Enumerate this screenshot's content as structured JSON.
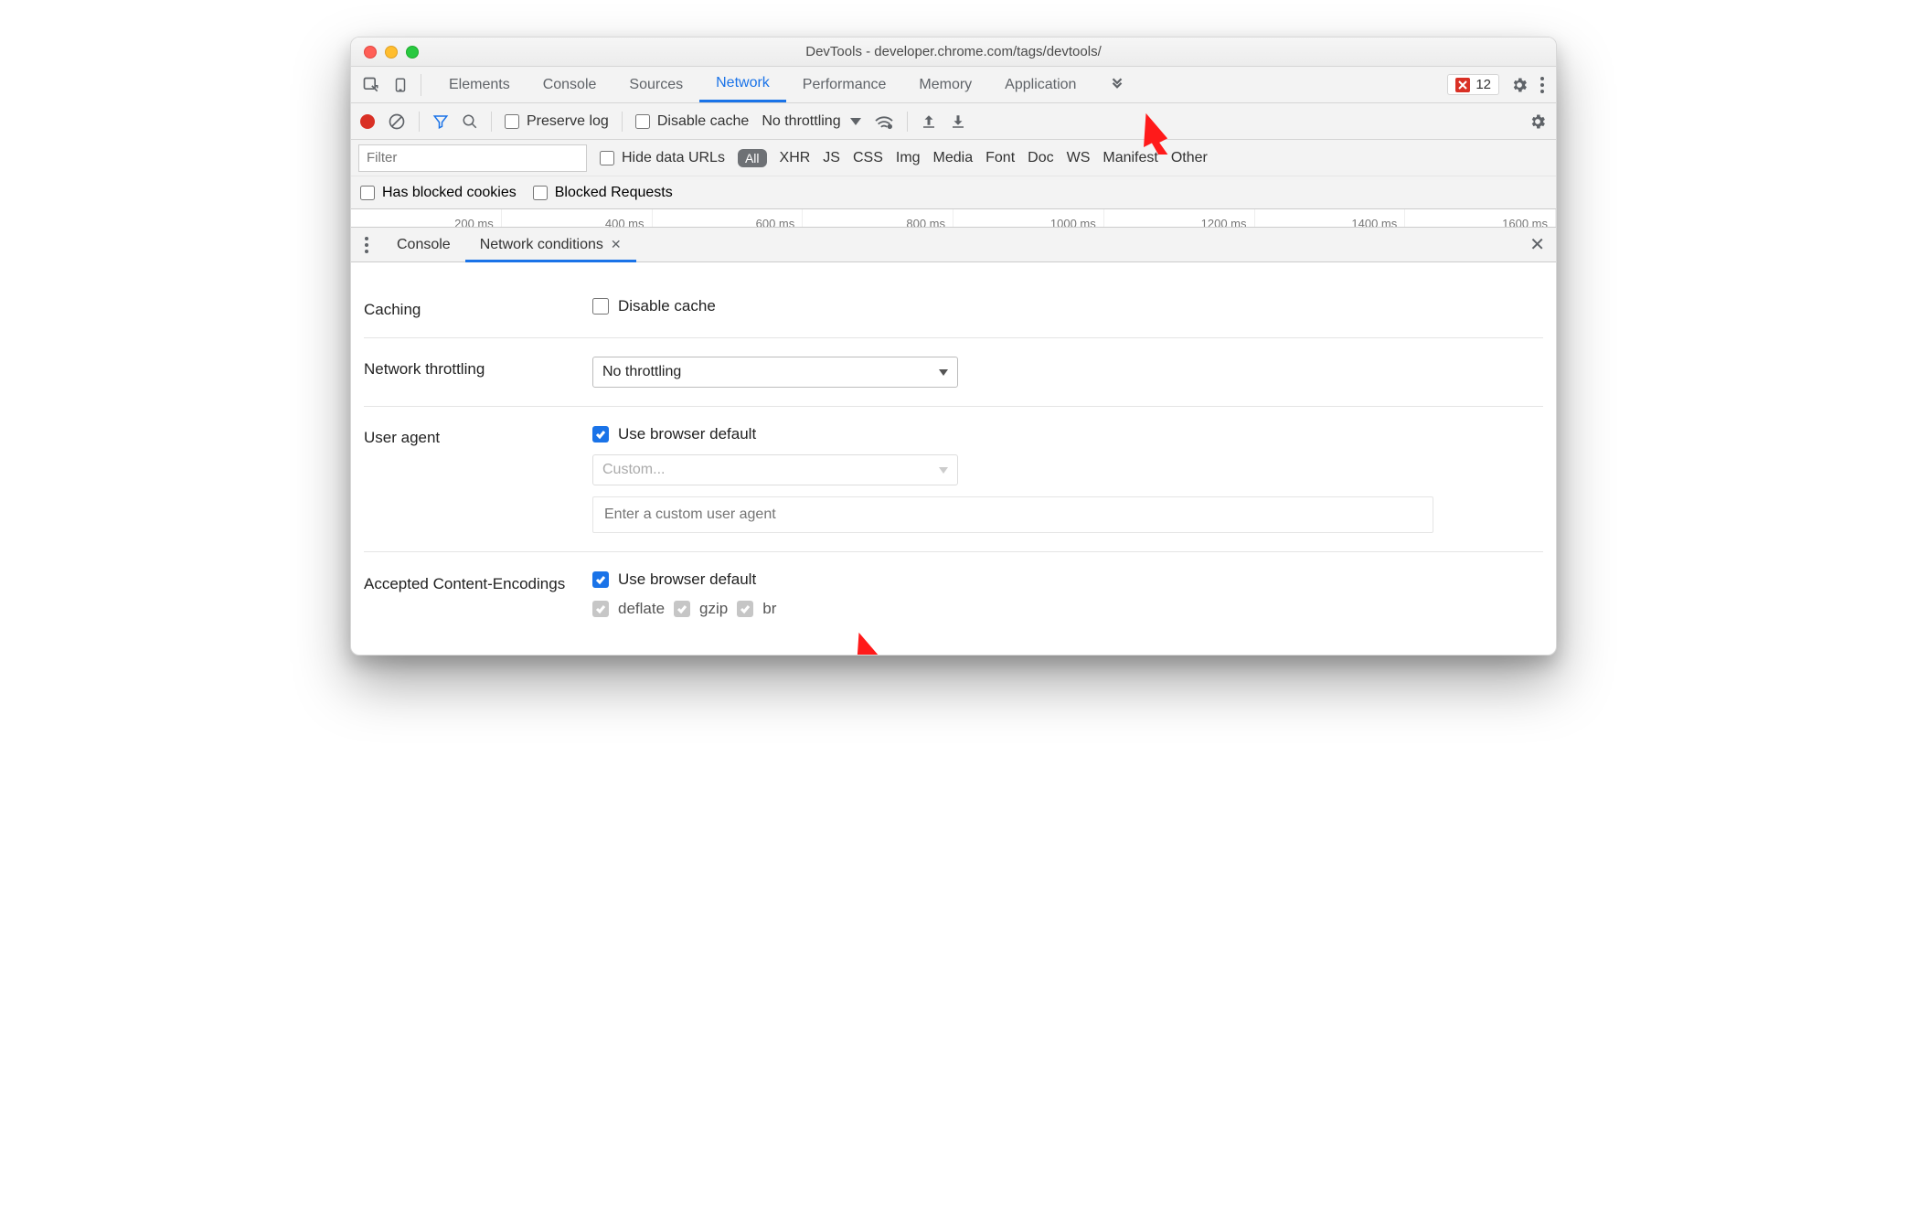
{
  "window": {
    "title": "DevTools - developer.chrome.com/tags/devtools/"
  },
  "main_tabs": {
    "items": [
      "Elements",
      "Console",
      "Sources",
      "Network",
      "Performance",
      "Memory",
      "Application"
    ],
    "active": "Network",
    "error_count": "12"
  },
  "toolbar": {
    "preserve_log": "Preserve log",
    "disable_cache": "Disable cache",
    "throttling": "No throttling"
  },
  "filter_row": {
    "placeholder": "Filter",
    "hide_data_urls": "Hide data URLs",
    "pill_all": "All",
    "types": [
      "XHR",
      "JS",
      "CSS",
      "Img",
      "Media",
      "Font",
      "Doc",
      "WS",
      "Manifest",
      "Other"
    ]
  },
  "cookies_row": {
    "blocked_cookies": "Has blocked cookies",
    "blocked_requests": "Blocked Requests"
  },
  "timeline": [
    "200 ms",
    "400 ms",
    "600 ms",
    "800 ms",
    "1000 ms",
    "1200 ms",
    "1400 ms",
    "1600 ms"
  ],
  "drawer": {
    "tabs": {
      "console": "Console",
      "network_conditions": "Network conditions"
    }
  },
  "sections": {
    "caching": {
      "label": "Caching",
      "disable_cache": "Disable cache"
    },
    "throttling": {
      "label": "Network throttling",
      "value": "No throttling"
    },
    "user_agent": {
      "label": "User agent",
      "use_default": "Use browser default",
      "custom_placeholder": "Custom...",
      "input_placeholder": "Enter a custom user agent"
    },
    "encodings": {
      "label": "Accepted Content-Encodings",
      "use_default": "Use browser default",
      "items": [
        "deflate",
        "gzip",
        "br"
      ]
    }
  }
}
